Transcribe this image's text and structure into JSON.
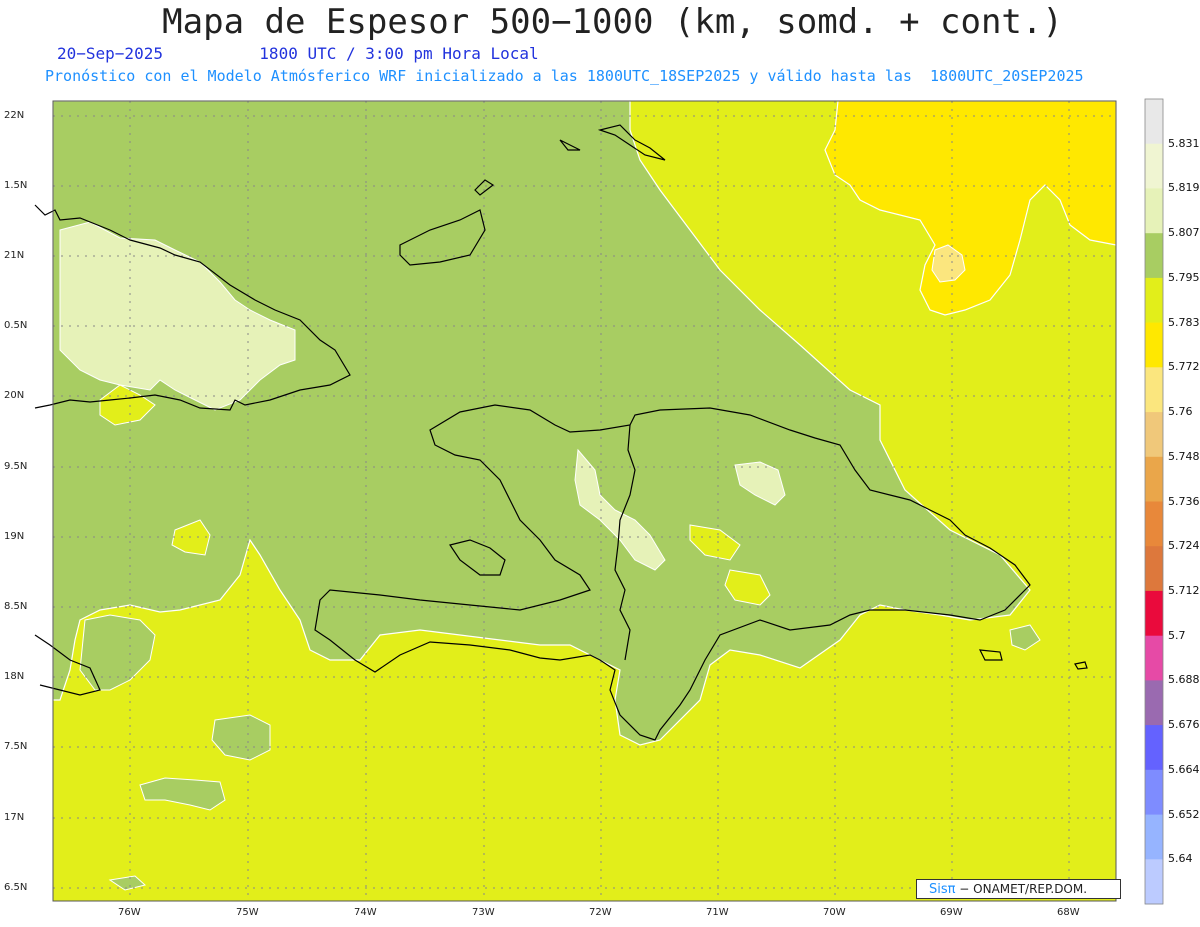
{
  "title": "Mapa de Espesor 500−1000 (km, somd. + cont.)",
  "date": "20−Sep−2025",
  "time_label": "1800 UTC / 3:00 pm Hora Local",
  "subtitle": "Pronóstico con el Modelo Atmósferico WRF inicializado a las 1800UTC_18SEP2025 y válido hasta las  1800UTC_20SEP2025",
  "credit": {
    "brand": "Sisπ",
    "text": " − ONAMET/REP.DOM."
  },
  "lat_ticks": [
    "22N",
    "1.5N",
    "21N",
    "0.5N",
    "20N",
    "9.5N",
    "19N",
    "8.5N",
    "18N",
    "7.5N",
    "17N",
    "6.5N"
  ],
  "lon_ticks": [
    "76W",
    "75W",
    "74W",
    "73W",
    "72W",
    "71W",
    "70W",
    "69W",
    "68W"
  ],
  "colorbar": {
    "labels": [
      "5.831",
      "5.819",
      "5.807",
      "5.795",
      "5.783",
      "5.772",
      "5.76",
      "5.748",
      "5.736",
      "5.724",
      "5.712",
      "5.7",
      "5.688",
      "5.676",
      "5.664",
      "5.652",
      "5.64"
    ],
    "colors": [
      "#e8e8e8",
      "#f0f5d2",
      "#e6f2b8",
      "#a8cd62",
      "#e2ee1a",
      "#ffe800",
      "#fbe67e",
      "#f0c87a",
      "#eaa64a",
      "#e8883a",
      "#dd783c",
      "#ea0a3c",
      "#e64aa6",
      "#9a6ab0",
      "#6462ff",
      "#7e8cff",
      "#96b4ff",
      "#bccbff"
    ]
  },
  "legend_colors": {
    "band_5795": "#a8cd62",
    "band_5807": "#e6f2b8",
    "band_5783": "#e2ee1a",
    "band_5772": "#ffe800",
    "band_5760": "#fbe67e",
    "coast": "#000000",
    "contour": "#ffffff"
  }
}
